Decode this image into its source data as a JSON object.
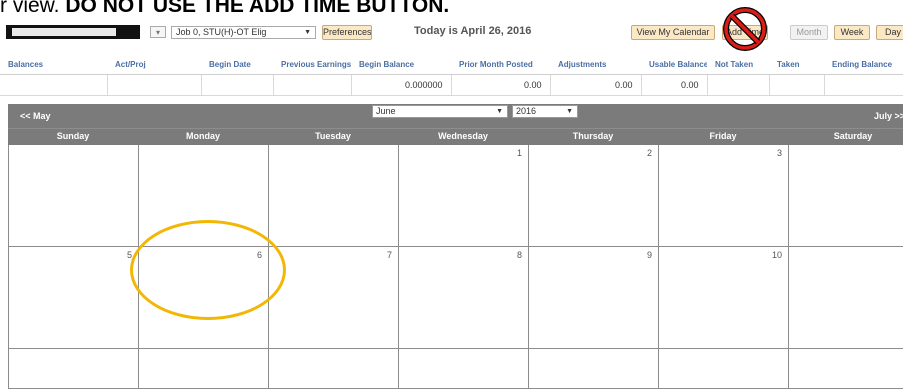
{
  "banner": {
    "prefix": "r view.",
    "warning": "DO NOT USE THE ADD TIME BUTTON."
  },
  "toolbar": {
    "job_select": "Job 0, STU(H)-OT Elig",
    "preferences": "Preferences",
    "today": "Today is April 26, 2016",
    "view_calendar": "View My Calendar",
    "add_time": "Add Time",
    "month": "Month",
    "week": "Week",
    "day": "Day"
  },
  "balances": {
    "headers": [
      "Balances",
      "Act/Proj",
      "Begin Date",
      "Previous Earnings",
      "Begin Balance",
      "Prior Month Posted",
      "Adjustments",
      "Usable Balance",
      "Not Taken",
      "Taken",
      "Ending Balance"
    ],
    "row": [
      "",
      "",
      "",
      "",
      "0.000000",
      "0.00",
      "0.00",
      "0.00",
      "",
      "",
      ""
    ]
  },
  "calendar": {
    "prev": "<< May",
    "next": "July >>",
    "month_value": "June",
    "year_value": "2016",
    "days": [
      "Sunday",
      "Monday",
      "Tuesday",
      "Wednesday",
      "Thursday",
      "Friday",
      "Saturday"
    ],
    "weeks": [
      [
        "",
        "",
        "",
        "1",
        "2",
        "3",
        ""
      ],
      [
        "5",
        "6",
        "7",
        "8",
        "9",
        "10",
        ""
      ],
      [
        "",
        "",
        "",
        "",
        "",
        "",
        ""
      ]
    ]
  },
  "colors": {
    "highlight_circle": "#f2b705",
    "nav_bar": "#7b7b7b",
    "header_text": "#4a6fa5",
    "button_bg": "#fbe9c6"
  }
}
